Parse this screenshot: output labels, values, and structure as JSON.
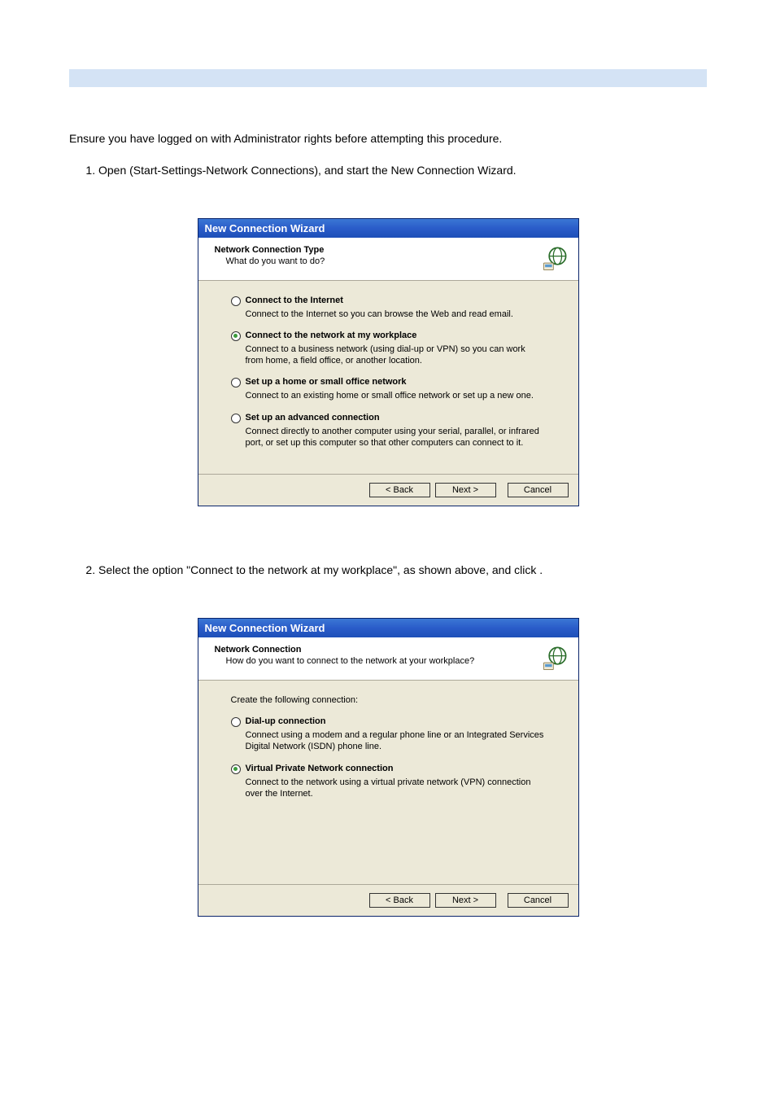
{
  "page": {
    "intro": "Ensure you have logged on with Administrator rights before attempting this procedure.",
    "step1_prefix": "Open ",
    "step1_suffix": " (Start-Settings-Network Connections), and start the New Connection Wizard.",
    "step2_prefix": "Select the option \"Connect to the network at my workplace\", as shown above, and click ",
    "step2_suffix": "."
  },
  "wizard1": {
    "title": "New Connection Wizard",
    "header_title": "Network Connection Type",
    "header_sub": "What do you want to do?",
    "options": [
      {
        "label": "Connect to the Internet",
        "desc": "Connect to the Internet so you can browse the Web and read email.",
        "selected": false
      },
      {
        "label": "Connect to the network at my workplace",
        "desc": "Connect to a business network (using dial-up or VPN) so you can work from home, a field office, or another location.",
        "selected": true
      },
      {
        "label": "Set up a home or small office network",
        "desc": "Connect to an existing home or small office network or set up a new one.",
        "selected": false
      },
      {
        "label": "Set up an advanced connection",
        "desc": "Connect directly to another computer using your serial, parallel, or infrared port, or set up this computer so that other computers can connect to it.",
        "selected": false
      }
    ],
    "buttons": {
      "back": "< Back",
      "next": "Next >",
      "cancel": "Cancel"
    }
  },
  "wizard2": {
    "title": "New Connection Wizard",
    "header_title": "Network Connection",
    "header_sub": "How do you want to connect to the network at your workplace?",
    "body_intro": "Create the following connection:",
    "options": [
      {
        "label": "Dial-up connection",
        "desc": "Connect using a modem and a regular phone line or an Integrated Services Digital Network (ISDN) phone line.",
        "selected": false
      },
      {
        "label": "Virtual Private Network connection",
        "desc": "Connect to the network using a virtual private network (VPN) connection over the Internet.",
        "selected": true
      }
    ],
    "buttons": {
      "back": "< Back",
      "next": "Next >",
      "cancel": "Cancel"
    }
  }
}
